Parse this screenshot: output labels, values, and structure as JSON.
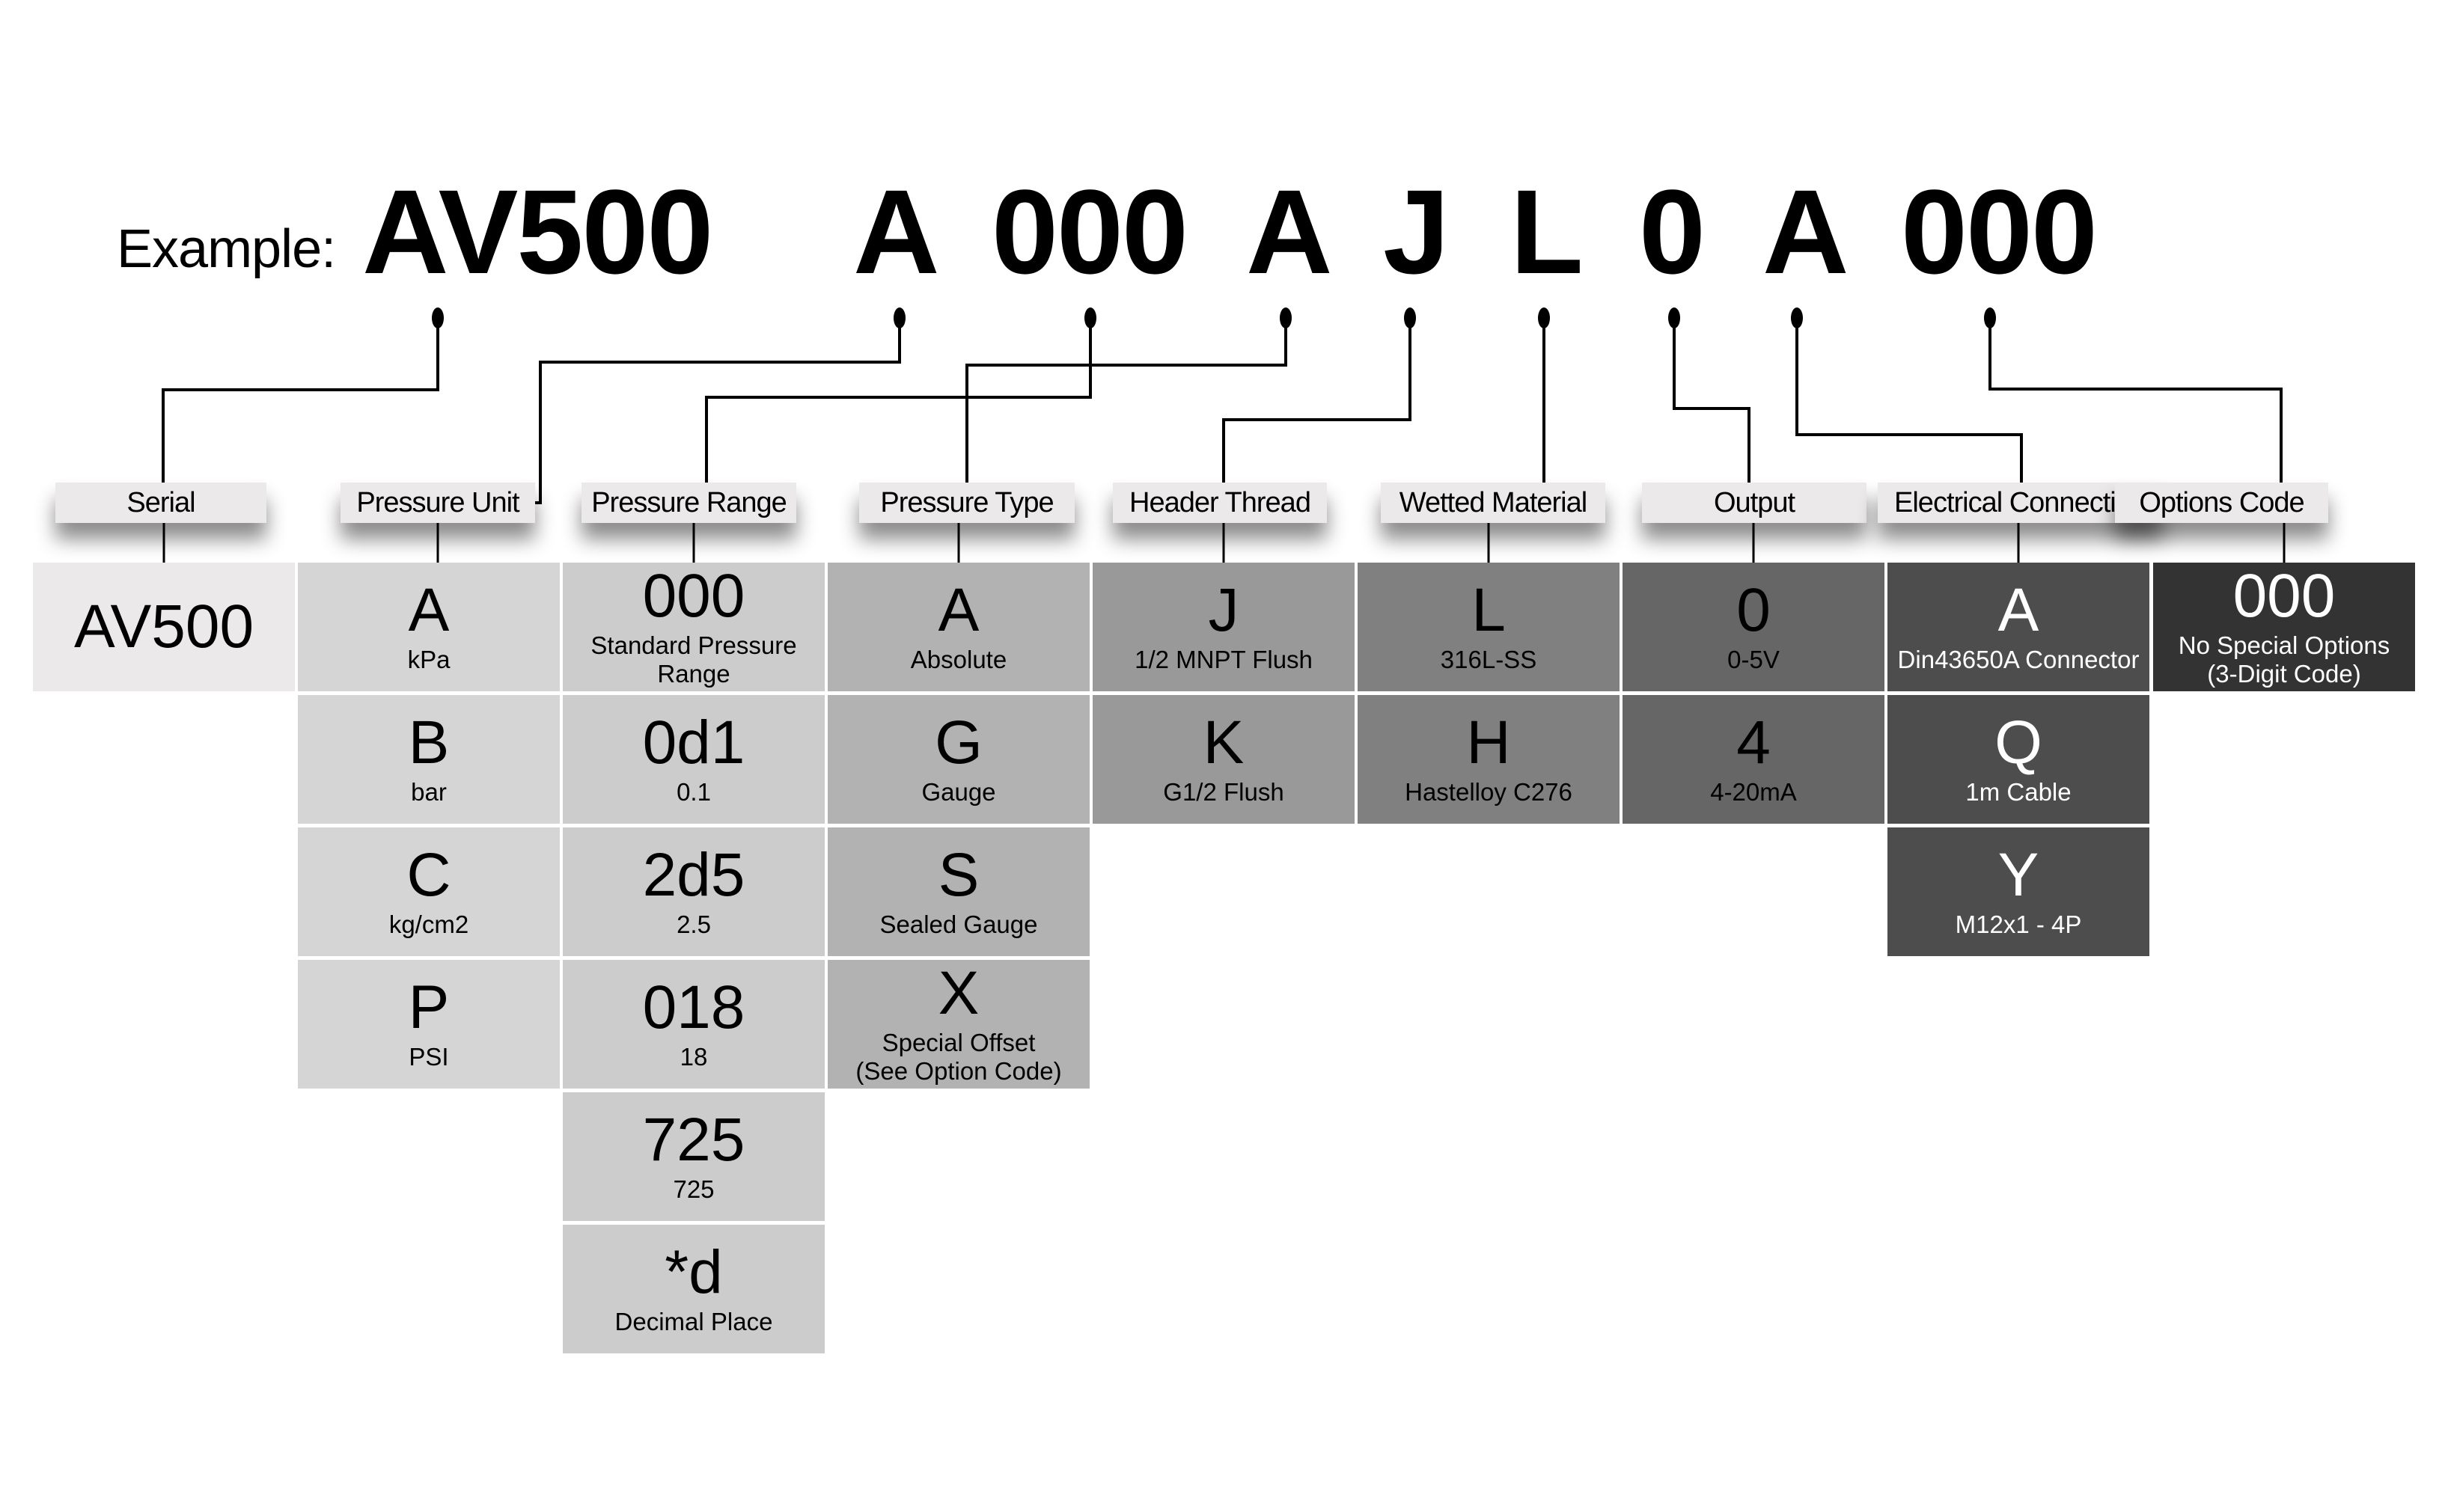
{
  "example": {
    "label": "Example:",
    "segments": [
      "AV500",
      "A",
      "000",
      "A",
      "J",
      "L",
      "0",
      "A",
      "000"
    ]
  },
  "columns": [
    {
      "key": "serial",
      "header": "Serial",
      "bg": "#ebe9ea",
      "fg": "#000000",
      "options": [
        {
          "code": "AV500",
          "desc": ""
        }
      ]
    },
    {
      "key": "pressure-unit",
      "header": "Pressure Unit",
      "bg": "#d6d5d6",
      "fg": "#000000",
      "options": [
        {
          "code": "A",
          "desc": "kPa"
        },
        {
          "code": "B",
          "desc": "bar"
        },
        {
          "code": "C",
          "desc": "kg/cm2"
        },
        {
          "code": "P",
          "desc": "PSI"
        }
      ]
    },
    {
      "key": "pressure-range",
      "header": "Pressure Range",
      "bg": "#cccccc",
      "fg": "#000000",
      "options": [
        {
          "code": "000",
          "desc": "Standard Pressure Range"
        },
        {
          "code": "0d1",
          "desc": "0.1"
        },
        {
          "code": "2d5",
          "desc": "2.5"
        },
        {
          "code": "018",
          "desc": "18"
        },
        {
          "code": "725",
          "desc": "725"
        },
        {
          "code": "*d",
          "desc": "Decimal Place"
        }
      ]
    },
    {
      "key": "pressure-type",
      "header": "Pressure Type",
      "bg": "#b2b2b2",
      "fg": "#000000",
      "options": [
        {
          "code": "A",
          "desc": "Absolute"
        },
        {
          "code": "G",
          "desc": "Gauge"
        },
        {
          "code": "S",
          "desc": "Sealed Gauge"
        },
        {
          "code": "X",
          "desc": "Special Offset\n(See Option Code)"
        }
      ]
    },
    {
      "key": "header-thread",
      "header": "Header Thread",
      "bg": "#999999",
      "fg": "#000000",
      "options": [
        {
          "code": "J",
          "desc": "1/2 MNPT Flush"
        },
        {
          "code": "K",
          "desc": "G1/2 Flush"
        }
      ]
    },
    {
      "key": "wetted-material",
      "header": "Wetted Material",
      "bg": "#808080",
      "fg": "#000000",
      "options": [
        {
          "code": "L",
          "desc": "316L-SS"
        },
        {
          "code": "H",
          "desc": "Hastelloy C276"
        }
      ]
    },
    {
      "key": "output",
      "header": "Output",
      "bg": "#666666",
      "fg": "#000000",
      "options": [
        {
          "code": "0",
          "desc": "0-5V"
        },
        {
          "code": "4",
          "desc": "4-20mA"
        }
      ]
    },
    {
      "key": "electrical-connection",
      "header": "Electrical Connection",
      "bg": "#4d4d4d",
      "fg": "#ffffff",
      "options": [
        {
          "code": "A",
          "desc": "Din43650A Connector"
        },
        {
          "code": "Q",
          "desc": "1m Cable"
        },
        {
          "code": "Y",
          "desc": "M12x1 - 4P"
        }
      ]
    },
    {
      "key": "options-code",
      "header": "Options Code",
      "bg": "#333333",
      "fg": "#ffffff",
      "options": [
        {
          "code": "000",
          "desc": "No Special Options\n(3-Digit Code)"
        }
      ]
    }
  ]
}
